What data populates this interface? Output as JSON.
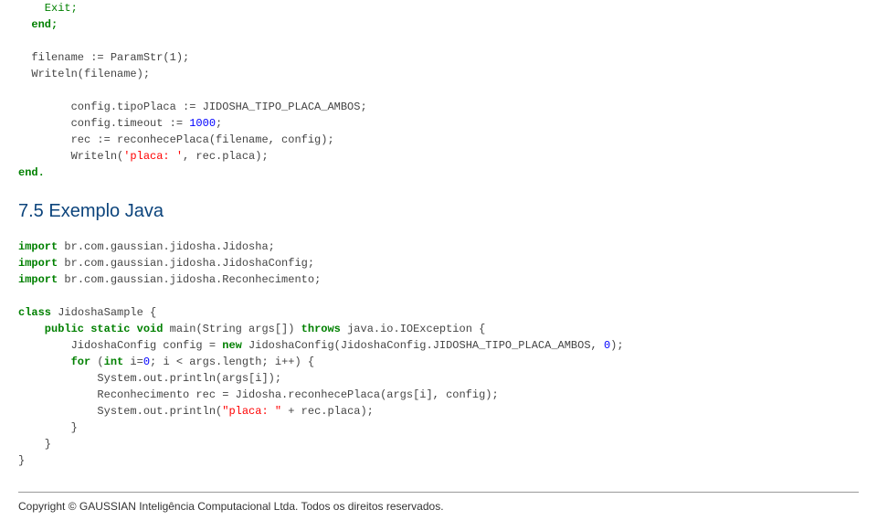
{
  "pascal": {
    "l1": "    Exit;",
    "l2": "  end;",
    "l3": "",
    "l4": "  filename := ParamStr(1);",
    "l5": "  Writeln(filename);",
    "l6": "",
    "l7": "        config.tipoPlaca := JIDOSHA_TIPO_PLACA_AMBOS;",
    "l8a": "        config.timeout := ",
    "l8b": "1000",
    "l8c": ";",
    "l9": "        rec := reconhecePlaca(filename, config);",
    "l10a": "        Writeln(",
    "l10b": "'placa: '",
    "l10c": ", rec.placa);",
    "l11": "end."
  },
  "heading": "7.5 Exemplo Java",
  "java": {
    "l1a": "import",
    "l1b": " br.com.gaussian.jidosha.Jidosha;",
    "l2a": "import",
    "l2b": " br.com.gaussian.jidosha.JidoshaConfig;",
    "l3a": "import",
    "l3b": " br.com.gaussian.jidosha.Reconhecimento;",
    "l4": "",
    "l5a": "class",
    "l5b": " JidoshaSample {",
    "l6a": "    public static void",
    "l6b": " main(String args[]) ",
    "l6c": "throws",
    "l6d": " java.io.IOException {",
    "l7a": "        JidoshaConfig config = ",
    "l7b": "new",
    "l7c": " JidoshaConfig(JidoshaConfig.JIDOSHA_TIPO_PLACA_AMBOS, ",
    "l7d": "0",
    "l7e": ");",
    "l8a": "        for",
    "l8b": " (",
    "l8c": "int",
    "l8d": " i=",
    "l8e": "0",
    "l8f": "; i < args.length; i++) {",
    "l9": "            System.out.println(args[i]);",
    "l10": "            Reconhecimento rec = Jidosha.reconhecePlaca(args[i], config);",
    "l11a": "            System.out.println(",
    "l11b": "\"placa: \"",
    "l11c": " + rec.placa);",
    "l12": "        }",
    "l13": "    }",
    "l14": "}"
  },
  "footer": "Copyright © GAUSSIAN Inteligência Computacional Ltda. Todos os direitos reservados."
}
